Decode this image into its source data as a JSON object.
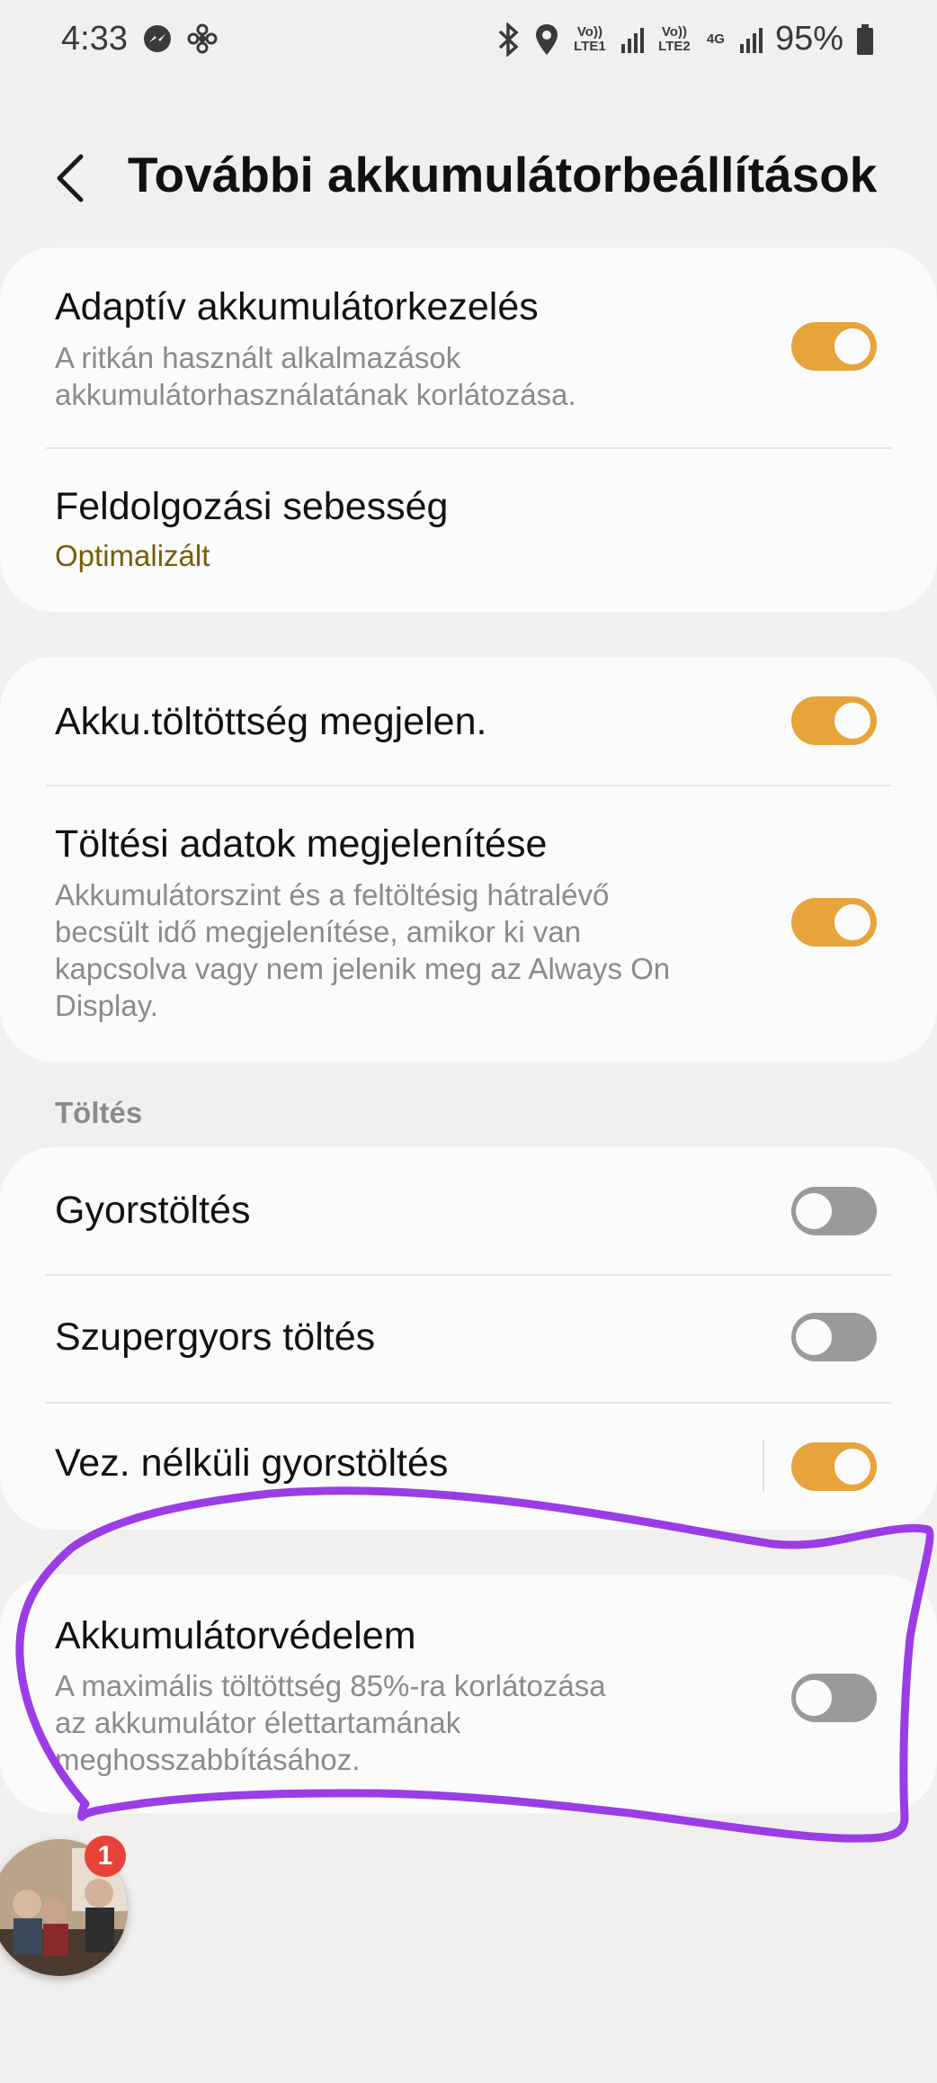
{
  "status_bar": {
    "time": "4:33",
    "lte1": "Vo)) LTE1",
    "lte2": "Vo)) LTE2",
    "net": "4G",
    "battery_percent": "95%"
  },
  "header": {
    "title": "További akkumulátorbeállítások"
  },
  "cards": {
    "adaptive": {
      "title": "Adaptív akkumulátorkezelés",
      "desc_line1": "A ritkán használt alkalmazások",
      "desc_line2": "akkumulátorhasználatának korlátozása.",
      "toggle_on": true
    },
    "processing": {
      "title": "Feldolgozási sebesség",
      "value": "Optimalizált"
    },
    "show_percent": {
      "title": "Akku.töltöttség megjelen.",
      "toggle_on": true
    },
    "charging_info": {
      "title": "Töltési adatok megjelenítése",
      "desc_line1": "Akkumulátorszint és a feltöltésig hátralévő",
      "desc_line2": "becsült idő megjelenítése, amikor ki van",
      "desc_line3": "kapcsolva vagy nem jelenik meg az Always On",
      "desc_line4": "Display.",
      "toggle_on": true
    }
  },
  "charging_section": {
    "label": "Töltés",
    "fast": {
      "title": "Gyorstöltés",
      "toggle_on": false
    },
    "super_fast": {
      "title": "Szupergyors töltés",
      "toggle_on": false
    },
    "wireless_fast": {
      "title": "Vez. nélküli gyorstöltés",
      "toggle_on": true
    }
  },
  "protection": {
    "title": "Akkumulátorvédelem",
    "desc_line1": "A maximális töltöttség 85%-ra korlátozása",
    "desc_line2": "az akkumulátor élettartamának",
    "desc_line3": "meghosszabbításához.",
    "toggle_on": false
  },
  "chat_head": {
    "badge_count": "1"
  },
  "colors": {
    "accent": "#e6a43a",
    "annotation": "#9b3de6",
    "badge": "#e8433b",
    "background": "#f1f0ef"
  }
}
